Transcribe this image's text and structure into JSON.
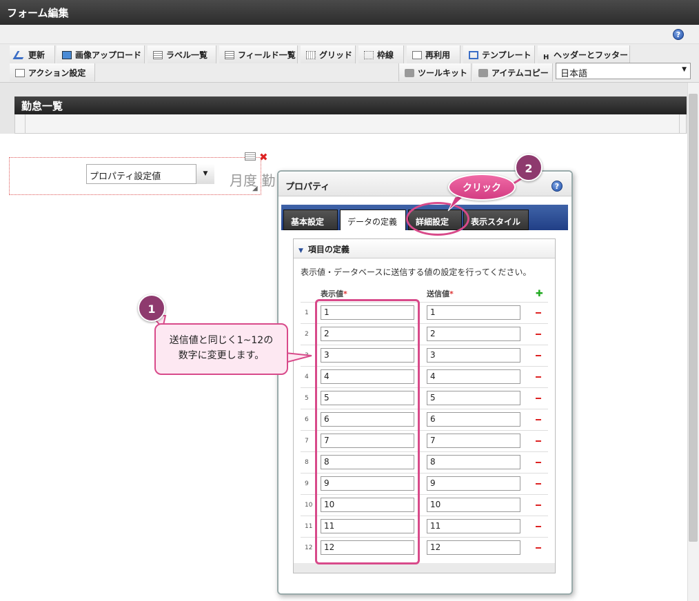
{
  "app": {
    "title": "フォーム編集"
  },
  "toolbar": {
    "items": [
      {
        "label": "更新",
        "icon": "update-icon"
      },
      {
        "label": "画像アップロード",
        "icon": "image-upload-icon"
      },
      {
        "label": "ラベル一覧",
        "icon": "label-list-icon"
      },
      {
        "label": "フィールド一覧",
        "icon": "field-list-icon"
      },
      {
        "label": "グリッド",
        "icon": "grid-icon"
      },
      {
        "label": "枠線",
        "icon": "border-icon"
      },
      {
        "label": "再利用",
        "icon": "reuse-icon"
      },
      {
        "label": "テンプレート",
        "icon": "template-icon"
      },
      {
        "label": "ヘッダーとフッター",
        "icon": "header-footer-icon"
      }
    ],
    "row2": [
      {
        "label": "アクション設定",
        "icon": "action-icon"
      },
      {
        "label": "ツールキット",
        "icon": "toolkit-icon"
      },
      {
        "label": "アイテムコピー",
        "icon": "item-copy-icon"
      }
    ],
    "language": "日本語",
    "header_footer_glyph": "H"
  },
  "form": {
    "title": "勤怠一覧",
    "select_value": "プロパティ設定値",
    "bg_text": "月度 勤"
  },
  "dialog": {
    "title": "プロパティ",
    "tabs": [
      "基本設定",
      "データの定義",
      "詳細設定",
      "表示スタイル"
    ],
    "active_tab": "データの定義",
    "section": "項目の定義",
    "description": "表示値・データベースに送信する値の設定を行ってください。",
    "col_display": "表示値",
    "col_send": "送信値",
    "required_mark": "*",
    "rows": [
      {
        "n": "1",
        "display": "1",
        "send": "1"
      },
      {
        "n": "2",
        "display": "2",
        "send": "2"
      },
      {
        "n": "3",
        "display": "3",
        "send": "3"
      },
      {
        "n": "4",
        "display": "4",
        "send": "4"
      },
      {
        "n": "5",
        "display": "5",
        "send": "5"
      },
      {
        "n": "6",
        "display": "6",
        "send": "6"
      },
      {
        "n": "7",
        "display": "7",
        "send": "7"
      },
      {
        "n": "8",
        "display": "8",
        "send": "8"
      },
      {
        "n": "9",
        "display": "9",
        "send": "9"
      },
      {
        "n": "10",
        "display": "10",
        "send": "10"
      },
      {
        "n": "11",
        "display": "11",
        "send": "11"
      },
      {
        "n": "12",
        "display": "12",
        "send": "12"
      }
    ]
  },
  "annotations": {
    "step1_number": "1",
    "step1_text_line1": "送信値と同じく1~12の",
    "step1_text_line2": "数字に変更します。",
    "step2_number": "2",
    "step2_text": "クリック",
    "highlight_color": "#d84a8a"
  },
  "help_glyph": "?",
  "close_glyph": "✖"
}
